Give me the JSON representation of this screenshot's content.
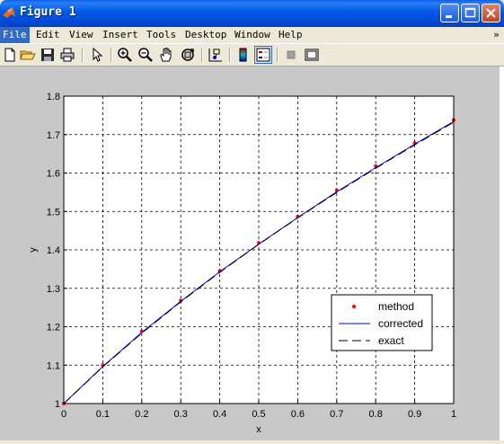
{
  "window": {
    "title": "Figure 1"
  },
  "menu": [
    "File",
    "Edit",
    "View",
    "Insert",
    "Tools",
    "Desktop",
    "Window",
    "Help"
  ],
  "menu_overflow": "»",
  "toolbar": [
    "new-figure",
    "open-file",
    "save",
    "print",
    "edit-plot",
    "zoom-in",
    "zoom-out",
    "pan",
    "rotate-3d",
    "data-cursor",
    "insert-colorbar",
    "insert-legend",
    "hide-plot-tools",
    "show-plot-tools"
  ],
  "chart_data": {
    "type": "line",
    "title": "",
    "xlabel": "x",
    "ylabel": "y",
    "xlim": [
      0,
      1
    ],
    "ylim": [
      1,
      1.8
    ],
    "xticks": [
      "0",
      "0.1",
      "0.2",
      "0.3",
      "0.4",
      "0.5",
      "0.6",
      "0.7",
      "0.8",
      "0.9",
      "1"
    ],
    "yticks": [
      "1",
      "1.1",
      "1.2",
      "1.3",
      "1.4",
      "1.5",
      "1.6",
      "1.7",
      "1.8"
    ],
    "grid": true,
    "legend_position": "lower-right",
    "series": [
      {
        "name": "method",
        "style": "red dots",
        "color": "#ff0000",
        "x": [
          0,
          0.1,
          0.2,
          0.3,
          0.4,
          0.5,
          0.6,
          0.7,
          0.8,
          0.9,
          1.0
        ],
        "y": [
          1.0,
          1.1,
          1.188,
          1.268,
          1.345,
          1.418,
          1.487,
          1.555,
          1.618,
          1.678,
          1.738
        ]
      },
      {
        "name": "corrected",
        "style": "blue solid line",
        "color": "#0000ff",
        "x": [
          0,
          0.1,
          0.2,
          0.3,
          0.4,
          0.5,
          0.6,
          0.7,
          0.8,
          0.9,
          1.0
        ],
        "y": [
          1.0,
          1.0963,
          1.185,
          1.266,
          1.343,
          1.415,
          1.484,
          1.551,
          1.614,
          1.675,
          1.734
        ]
      },
      {
        "name": "exact",
        "style": "black dashed line",
        "color": "#000000",
        "x": [
          0,
          0.1,
          0.2,
          0.3,
          0.4,
          0.5,
          0.6,
          0.7,
          0.8,
          0.9,
          1.0
        ],
        "y": [
          1.0,
          1.0954,
          1.1832,
          1.2649,
          1.3416,
          1.4142,
          1.4832,
          1.5492,
          1.6125,
          1.6733,
          1.7321
        ]
      }
    ]
  }
}
